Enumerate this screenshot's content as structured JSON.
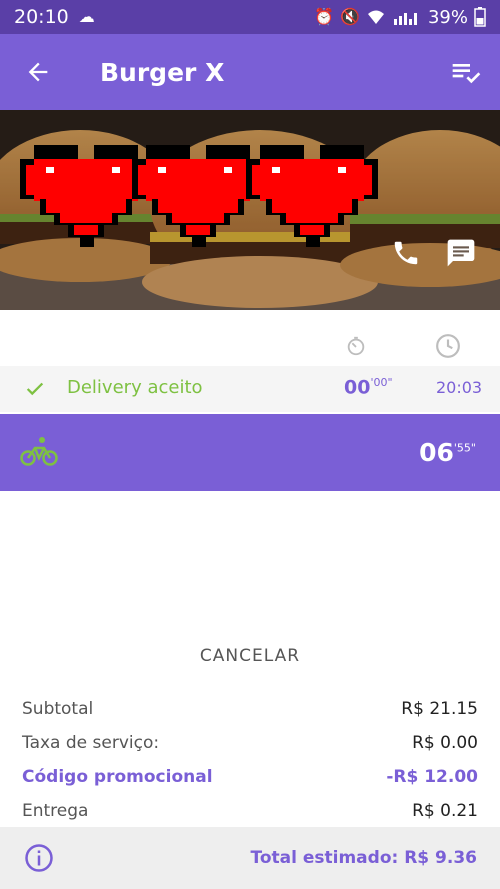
{
  "status_bar": {
    "time": "20:10",
    "battery": "39%"
  },
  "header": {
    "title": "Burger X"
  },
  "progress": {
    "status_label": "Delivery aceito",
    "elapsed_main": "00",
    "elapsed_sup": "'00\"",
    "clock_time": "20:03",
    "eta_main": "06",
    "eta_sup": "'55\""
  },
  "actions": {
    "cancel_label": "CANCELAR"
  },
  "summary": {
    "rows": [
      {
        "label": "Subtotal",
        "value": "R$ 21.15"
      },
      {
        "label": "Taxa de serviço:",
        "value": "R$ 0.00"
      },
      {
        "label": "Código promocional",
        "value": "-R$ 12.00"
      },
      {
        "label": "Entrega",
        "value": "R$ 0.21"
      }
    ],
    "total": "Total estimado: R$ 9.36"
  },
  "colors": {
    "brand": "#7a5fd6",
    "status_bar": "#5a3fa7",
    "success": "#7ec142"
  },
  "icons": [
    "back-arrow-icon",
    "list-check-icon",
    "phone-icon",
    "chat-icon",
    "timer-icon",
    "clock-icon",
    "check-icon",
    "bike-icon",
    "info-icon",
    "heart-icon"
  ]
}
